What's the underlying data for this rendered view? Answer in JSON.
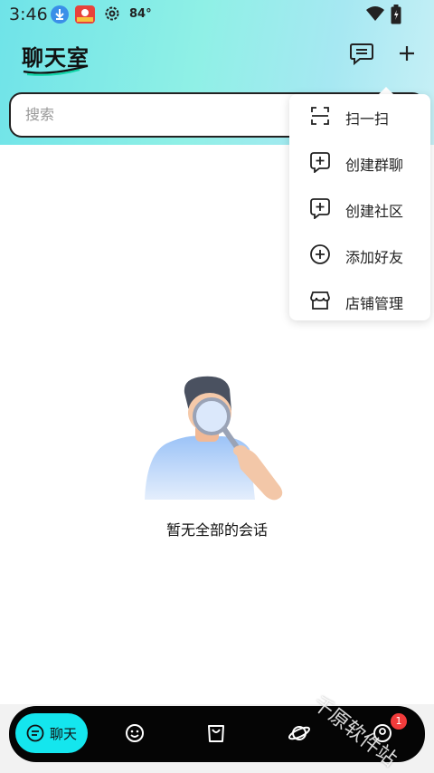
{
  "status_bar": {
    "time": "3:46",
    "temperature": "84°",
    "icons": [
      "download-icon",
      "app-notification-icon",
      "gear-icon",
      "wifi-icon",
      "battery-icon"
    ]
  },
  "header": {
    "title": "聊天室",
    "icons": [
      "message-list-icon",
      "plus-icon"
    ]
  },
  "search": {
    "placeholder": "搜索",
    "value": ""
  },
  "menu": {
    "items": [
      {
        "label": "扫一扫",
        "icon": "scan-icon"
      },
      {
        "label": "创建群聊",
        "icon": "chat-plus-icon"
      },
      {
        "label": "创建社区",
        "icon": "chat-plus-icon"
      },
      {
        "label": "添加好友",
        "icon": "circle-plus-icon"
      },
      {
        "label": "店铺管理",
        "icon": "store-icon"
      }
    ]
  },
  "empty_state": {
    "text": "暂无全部的会话"
  },
  "bottom_nav": {
    "items": [
      {
        "label": "聊天",
        "icon": "chat-icon",
        "active": true
      },
      {
        "label": "",
        "icon": "smiley-icon"
      },
      {
        "label": "",
        "icon": "shopping-bag-icon"
      },
      {
        "label": "",
        "icon": "planet-icon"
      },
      {
        "label": "",
        "icon": "profile-icon"
      }
    ],
    "badge": "1"
  },
  "watermark": "千原软件站",
  "colors": {
    "accent": "#14e6ee",
    "header_gradient_start": "#6fe3e8",
    "badge": "#f23b3b",
    "nav_bg": "#050505"
  }
}
